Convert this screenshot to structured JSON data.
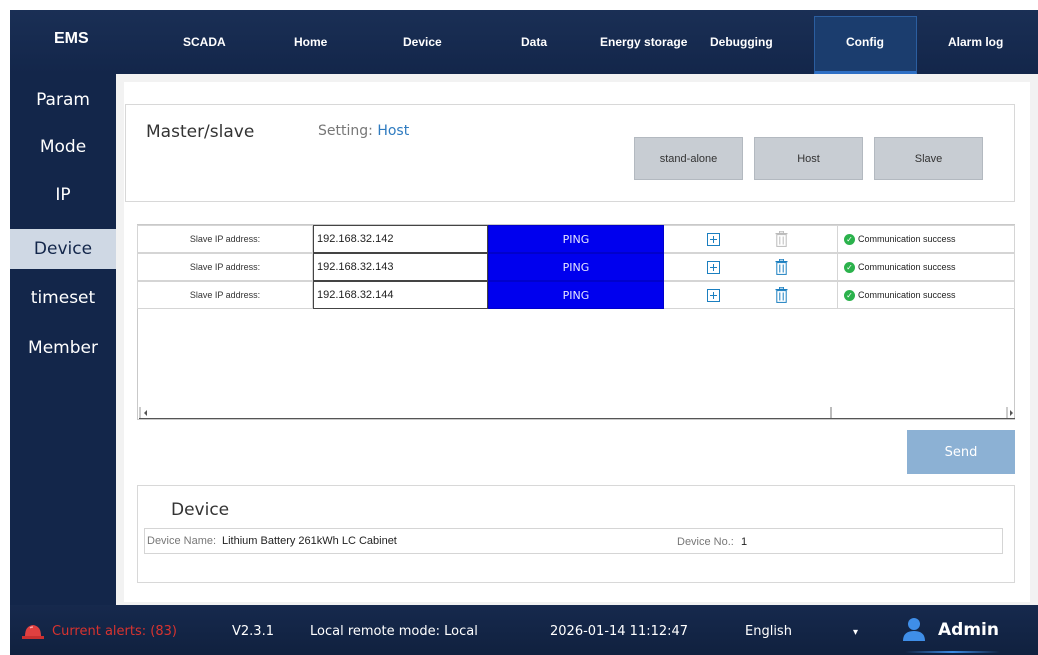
{
  "app": {
    "name": "EMS"
  },
  "nav": {
    "items": [
      {
        "label": "SCADA"
      },
      {
        "label": "Home"
      },
      {
        "label": "Device"
      },
      {
        "label": "Data"
      },
      {
        "label": "Energy storage"
      },
      {
        "label": "Debugging"
      },
      {
        "label": "Config",
        "active": true
      },
      {
        "label": "Alarm log"
      }
    ]
  },
  "sidebar": {
    "items": [
      {
        "label": "Param"
      },
      {
        "label": "Mode"
      },
      {
        "label": "IP"
      },
      {
        "label": "Device",
        "active": true
      },
      {
        "label": "timeset"
      },
      {
        "label": "Member"
      }
    ]
  },
  "master_slave": {
    "title": "Master/slave",
    "setting_label": "Setting:",
    "setting_value": "Host",
    "buttons": [
      {
        "label": "stand-alone"
      },
      {
        "label": "Host"
      },
      {
        "label": "Slave"
      }
    ]
  },
  "slave_list": {
    "rows": [
      {
        "label": "Slave IP address:",
        "ip": "192.168.32.142",
        "ping": "PING",
        "status": "Communication success",
        "delete_enabled": false
      },
      {
        "label": "Slave IP address:",
        "ip": "192.168.32.143",
        "ping": "PING",
        "status": "Communication success",
        "delete_enabled": true
      },
      {
        "label": "Slave IP address:",
        "ip": "192.168.32.144",
        "ping": "PING",
        "status": "Communication success",
        "delete_enabled": true
      }
    ],
    "send_label": "Send"
  },
  "device": {
    "title": "Device",
    "name_label": "Device Name:",
    "name_value": "Lithium Battery 261kWh LC Cabinet",
    "no_label": "Device No.:",
    "no_value": "1"
  },
  "footer": {
    "alerts_label": "Current alerts: (83)",
    "version": "V2.3.1",
    "remote_mode": "Local remote mode: Local",
    "datetime": "2026-01-14 11:12:47",
    "language": "English",
    "user": "Admin"
  },
  "colors": {
    "header_bg": "#13264a",
    "ping_bg": "#0000ee",
    "accent": "#2e7bc0",
    "success": "#2bb24c",
    "alert": "#d7332f",
    "send_bg": "#8cb1d4"
  }
}
